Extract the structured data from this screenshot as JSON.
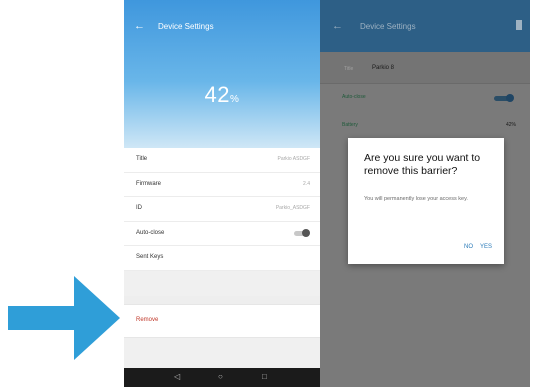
{
  "left_screen": {
    "title": "Device Settings",
    "battery_value": "42",
    "battery_unit": "%",
    "rows": [
      {
        "label": "Title",
        "value": "Parkio ASDGF"
      },
      {
        "label": "Firmware",
        "value": "2.4"
      },
      {
        "label": "ID",
        "value": "Parkio_ASDGF"
      },
      {
        "label": "Auto-close",
        "value": ""
      },
      {
        "label": "Sent Keys",
        "value": ""
      }
    ],
    "remove_label": "Remove"
  },
  "right_screen": {
    "title": "Device Settings",
    "title_key": "Title",
    "title_value": "Parkio 8",
    "auto_label": "Auto-close",
    "battery_label": "Battery",
    "battery_value": "42%",
    "dialog": {
      "question": "Are you sure you want to remove this barrier?",
      "message": "You will permanently lose your access key.",
      "no_label": "NO",
      "yes_label": "YES"
    }
  },
  "colors": {
    "arrow": "#2f9ed8",
    "header_blue": "#3f97dd",
    "remove_red": "#c0392b",
    "dialog_button_blue": "#2a7ab8"
  }
}
